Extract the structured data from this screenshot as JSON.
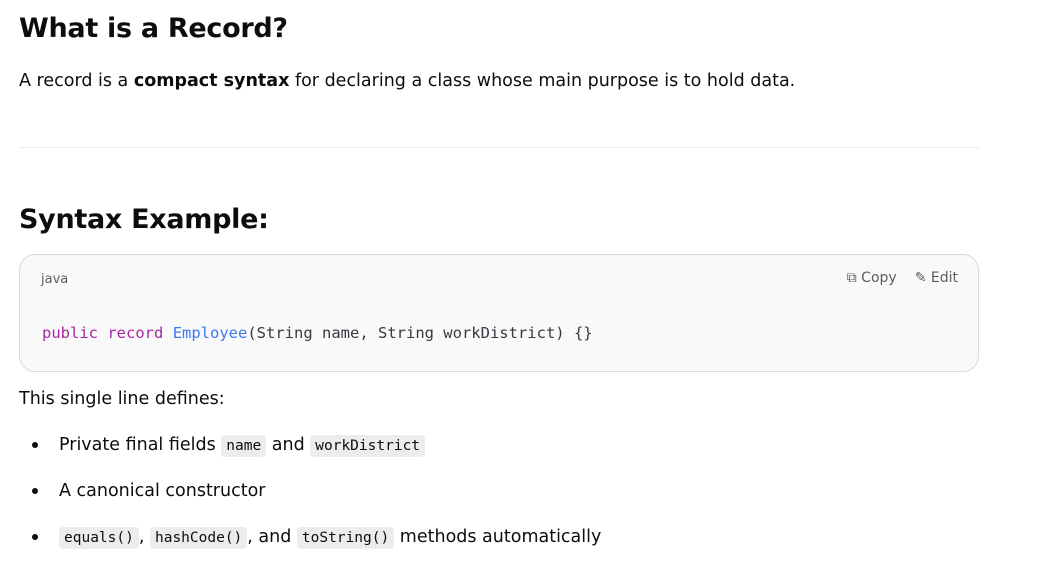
{
  "heading1": "What is a Record?",
  "intro": {
    "pre": "A record is a ",
    "bold": "compact syntax",
    "post": " for declaring a class whose main purpose is to hold data."
  },
  "heading2": "Syntax Example:",
  "codeblock": {
    "language": "java",
    "copy_label": "Copy",
    "edit_label": "Edit",
    "tokens": {
      "kw1": "public",
      "kw2": "record",
      "type": "Employee",
      "rest": "(String name, String workDistrict) {}"
    }
  },
  "defines": "This single line defines:",
  "bullets": [
    {
      "text": "Private final fields ",
      "code1": "name",
      "mid": " and ",
      "code2": "workDistrict"
    },
    {
      "text": "A canonical constructor"
    },
    {
      "code1": "equals()",
      "sep1": ", ",
      "code2": "hashCode()",
      "sep2": ", and ",
      "code3": "toString()",
      "post": " methods automatically"
    }
  ]
}
